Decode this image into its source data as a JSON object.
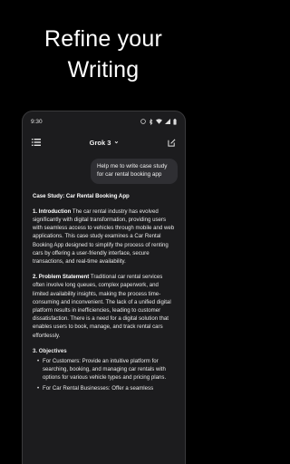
{
  "promo": {
    "line1": "Refine your",
    "line2": "Writing"
  },
  "status_bar": {
    "time": "9:30"
  },
  "app_bar": {
    "model_label": "Grok 3",
    "model_chevron": "⌄",
    "menu_icon": "hamburger-menu-icon",
    "compose_icon": "compose-icon"
  },
  "chat": {
    "user_message": "Help me to write case study for car rental booking app",
    "response": {
      "title": "Case Study: Car Rental Booking App",
      "intro_heading": "1. Introduction",
      "intro_text": " The car rental industry has evolved significantly with digital transformation, providing users with seamless access to vehicles through mobile and web applications. This case study examines a Car Rental Booking App designed to simplify the process of renting cars by offering a user-friendly interface, secure transactions, and real-time availability.",
      "problem_heading": "2. Problem Statement",
      "problem_text": " Traditional car rental services often involve long queues, complex paperwork, and limited availability insights, making the process time-consuming and inconvenient. The lack of a unified digital platform results in inefficiencies, leading to customer dissatisfaction. There is a need for a digital solution that enables users to book, manage, and track rental cars effortlessly.",
      "objectives_heading": "3. Objectives",
      "objectives": [
        "For Customers: Provide an intuitive platform for searching, booking, and managing car rentals with options for various vehicle types and pricing plans.",
        "For Car Rental Businesses: Offer a seamless"
      ]
    }
  }
}
